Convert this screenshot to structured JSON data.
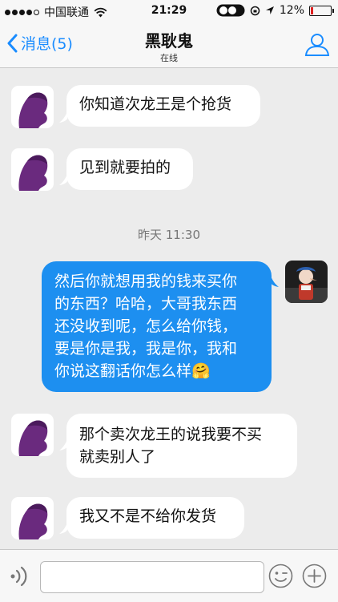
{
  "status_bar": {
    "carrier": "中国联通",
    "time": "21:29",
    "battery": "12%",
    "battery_fraction": 0.12
  },
  "nav": {
    "back_label": "消息(5)",
    "title": "黑耿鬼",
    "subtitle": "在线"
  },
  "messages": [
    {
      "direction": "in",
      "text": "你知道次龙王是个抢货"
    },
    {
      "direction": "in",
      "text": "见到就要拍的"
    },
    {
      "direction": "out",
      "lines": [
        "然后你就想用我的钱来买你",
        "的东西？哈哈，大哥我东西",
        "还没收到呢，怎么给你钱，",
        "要是你是我，我是你，我和",
        "你说这翻话你怎么样"
      ],
      "emoji": "🤗"
    },
    {
      "direction": "in",
      "lines": [
        "那个卖次龙王的说我要不买",
        "就卖别人了"
      ]
    },
    {
      "direction": "in",
      "text": "我又不是不给你发货"
    }
  ],
  "timestamp": "昨天 11:30",
  "input": {
    "placeholder": "",
    "value": ""
  },
  "colors": {
    "accent": "#1a8cff",
    "bubble_out": "#1d8ff0",
    "avatar_purple": "#6a2a7e"
  },
  "icons": [
    "signal-dots-icon",
    "wifi-icon",
    "back-chevron-icon",
    "profile-icon",
    "voice-icon",
    "emoji-icon",
    "plus-icon"
  ]
}
